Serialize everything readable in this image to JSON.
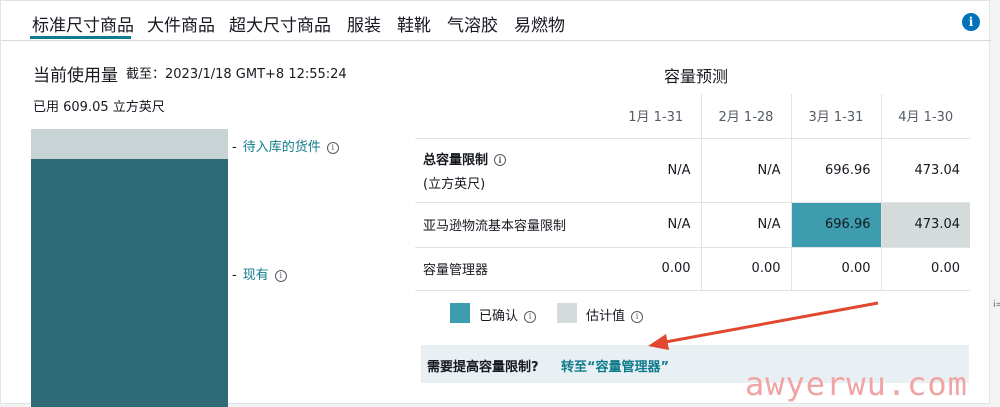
{
  "tabs": [
    {
      "label": "标准尺寸商品",
      "active": true
    },
    {
      "label": "大件商品"
    },
    {
      "label": "超大尺寸商品"
    },
    {
      "label": "服装"
    },
    {
      "label": "鞋靴"
    },
    {
      "label": "气溶胶"
    },
    {
      "label": "易燃物"
    }
  ],
  "info_icon": "i",
  "current": {
    "title": "当前使用量",
    "timestamp": "截至：2023/1/18 GMT+8 12:55:24",
    "used": "已用 609.05 立方英尺",
    "labels": {
      "pending": "待入库的货件",
      "existing": "现有"
    },
    "pending_fraction": 0.11
  },
  "forecast": {
    "title": "容量预测",
    "columns": [
      "1月 1-31",
      "2月 1-28",
      "3月 1-31",
      "4月 1-30"
    ],
    "rows": [
      {
        "label": "总容量限制",
        "sublabel": "(立方英尺)",
        "values": [
          "N/A",
          "N/A",
          "696.96",
          "473.04"
        ]
      },
      {
        "label": "亚马逊物流基本容量限制",
        "values": [
          "N/A",
          "N/A",
          "696.96",
          "473.04"
        ]
      },
      {
        "label": "容量管理器",
        "values": [
          "0.00",
          "0.00",
          "0.00",
          "0.00"
        ]
      }
    ],
    "legend": {
      "confirmed": "已确认",
      "estimated": "估计值"
    },
    "footer": {
      "question": "需要提高容量限制?",
      "link": "转至“容量管理器”"
    }
  },
  "colors": {
    "accent": "#0f7b8c",
    "confirmed": "#3d9dae",
    "estimated": "#d5dbdb",
    "bar_existing": "#2e6b76",
    "bar_pending": "#c8d3d5",
    "arrow": "#e2472f"
  },
  "watermark": "awyerwu.com",
  "edge_mark": "i="
}
